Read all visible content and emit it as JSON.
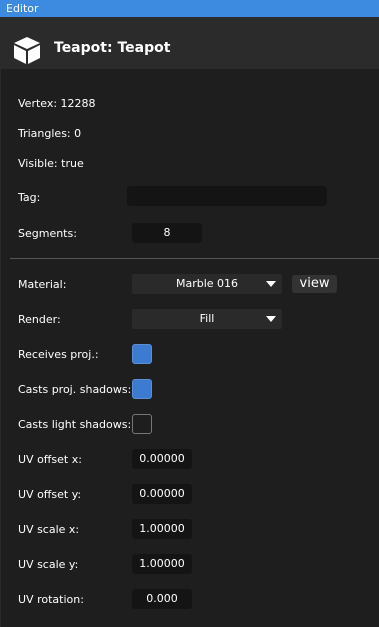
{
  "window": {
    "title": "Editor"
  },
  "object": {
    "title": "Teapot: Teapot",
    "icon": "cube-icon"
  },
  "info": {
    "vertex": "Vertex: 12288",
    "triangles": "Triangles: 0",
    "visible": "Visible: true"
  },
  "tag": {
    "label": "Tag:",
    "value": ""
  },
  "segments": {
    "label": "Segments:",
    "value": "8"
  },
  "material": {
    "label": "Material:",
    "value": "Marble 016",
    "view_label": "view"
  },
  "render": {
    "label": "Render:",
    "value": "Fill"
  },
  "receives_proj": {
    "label": "Receives proj.:",
    "checked": true
  },
  "casts_proj": {
    "label": "Casts proj. shadows:",
    "checked": true
  },
  "casts_light": {
    "label": "Casts light shadows:",
    "checked": false
  },
  "uv_offset_x": {
    "label": "UV offset x:",
    "value": "0.00000"
  },
  "uv_offset_y": {
    "label": "UV offset y:",
    "value": "0.00000"
  },
  "uv_scale_x": {
    "label": "UV scale x:",
    "value": "1.00000"
  },
  "uv_scale_y": {
    "label": "UV scale y:",
    "value": "1.00000"
  },
  "uv_rotation": {
    "label": "UV rotation:",
    "value": "0.000"
  },
  "colors": {
    "titlebar": "#3d8be0",
    "checkbox_on": "#3d7bd0",
    "background": "#1e1e1e"
  }
}
